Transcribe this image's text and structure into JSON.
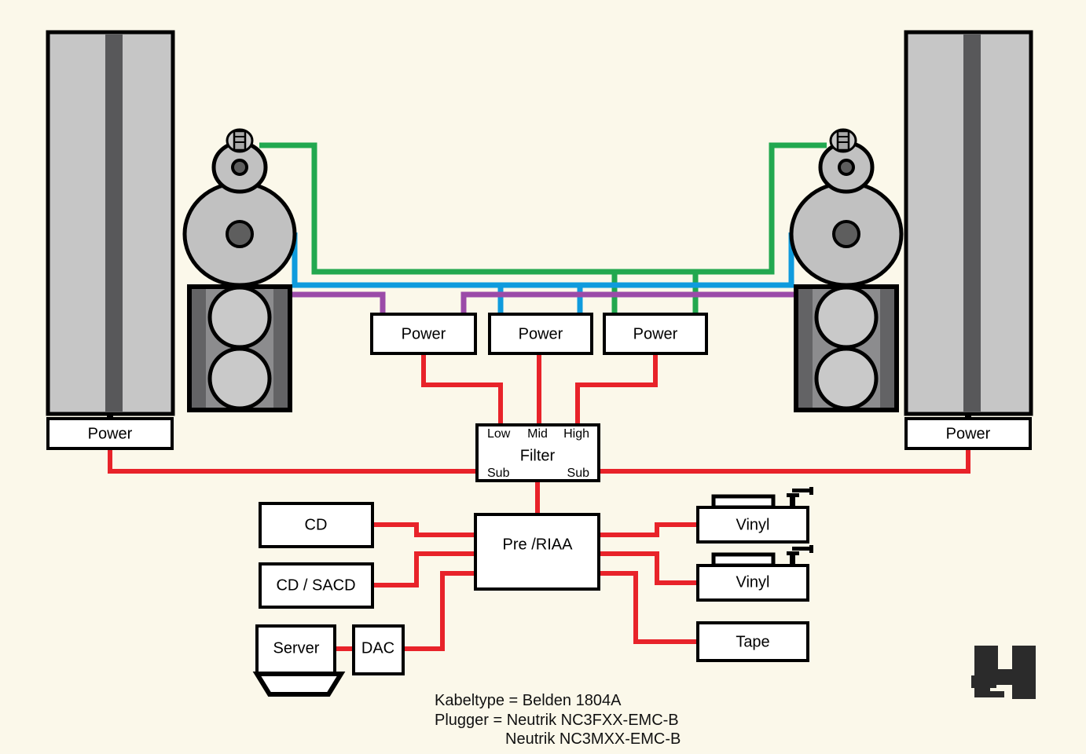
{
  "diagram": {
    "title": "Hi-Fi System Signal and Power Routing Diagram",
    "background_color": "#fbf8ea"
  },
  "colors": {
    "signal_red": "#e8232a",
    "tweeter_green": "#22a84f",
    "mid_blue": "#0f9bdd",
    "sub_purple": "#9b4ba8",
    "cabinet_gray": "#c6c6c6",
    "cabinet_stripe": "#58585a",
    "sub_case": "#8c8c8e",
    "outline_black": "#000000"
  },
  "amplifiers": {
    "left_tower_power": {
      "label": "Power"
    },
    "right_tower_power": {
      "label": "Power"
    },
    "bank": [
      {
        "label": "Power",
        "band": "low"
      },
      {
        "label": "Power",
        "band": "mid"
      },
      {
        "label": "Power",
        "band": "high"
      }
    ]
  },
  "filter": {
    "label": "Filter",
    "outputs_top": [
      "Low",
      "Mid",
      "High"
    ],
    "outputs_bottom": [
      "Sub",
      "Sub"
    ]
  },
  "preamp": {
    "label": "Pre /RIAA"
  },
  "sources_left": [
    {
      "label": "CD"
    },
    {
      "label": "CD / SACD"
    },
    {
      "label": "Server"
    },
    {
      "label": "DAC"
    }
  ],
  "sources_right": [
    {
      "label": "Vinyl"
    },
    {
      "label": "Vinyl"
    },
    {
      "label": "Tape"
    }
  ],
  "speakers": {
    "left_tower": {
      "name": "electrostatic-panel"
    },
    "right_tower": {
      "name": "electrostatic-panel"
    },
    "left_stack": {
      "name": "speaker-stack"
    },
    "right_stack": {
      "name": "speaker-stack"
    }
  },
  "notes": {
    "line1": "Kabeltype = Belden 1804A",
    "line2": "Plugger = Neutrik NC3FXX-EMC-B",
    "line3": "Neutrik NC3MXX-EMC-B"
  },
  "logo": {
    "name": "manufacturer-logo"
  }
}
